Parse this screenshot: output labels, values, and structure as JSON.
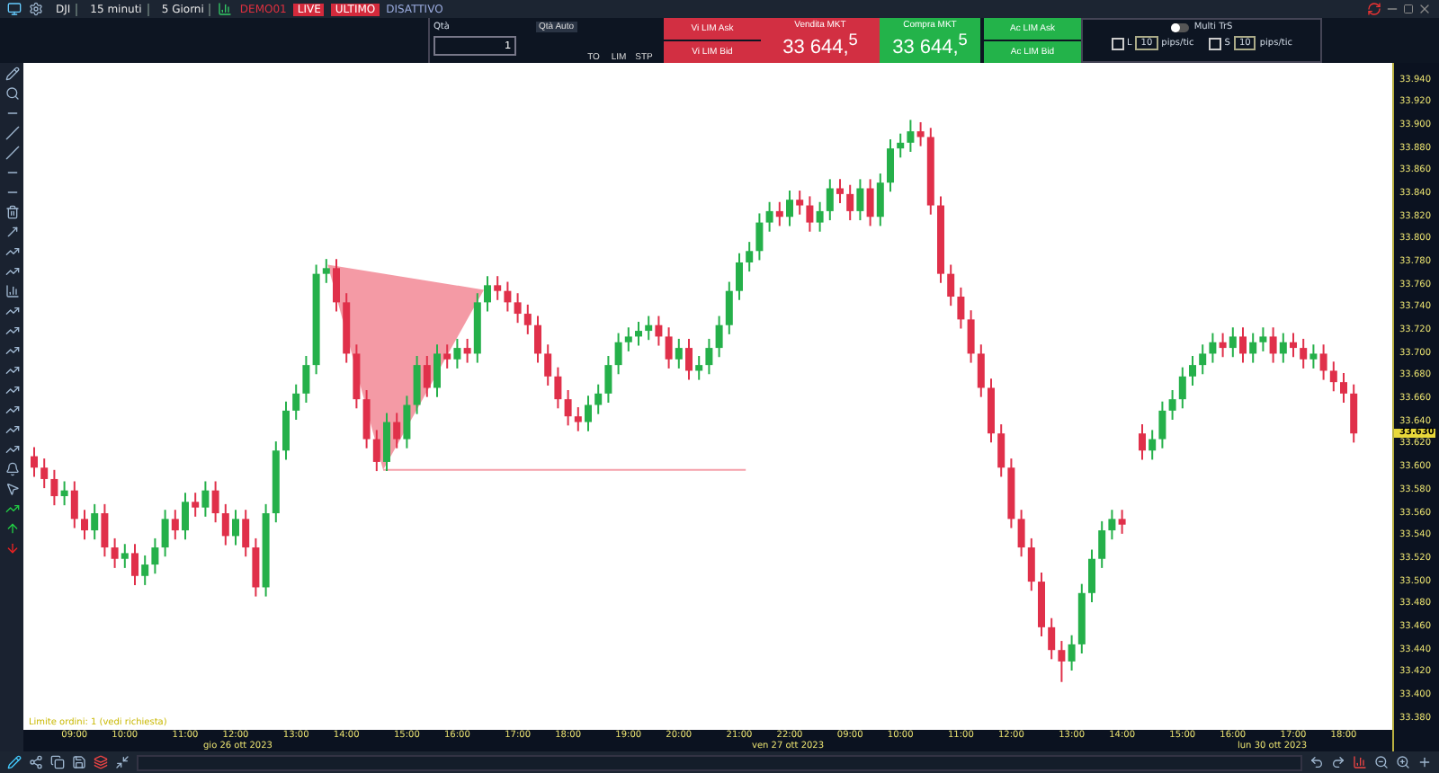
{
  "toolbar": {
    "symbol": "DJI",
    "timeframe": "15 minuti",
    "range": "5 Giorni",
    "account": "DEMO01",
    "badges": [
      "LIVE",
      "ULTIMO"
    ],
    "status": "DISATTIVO"
  },
  "order_panel": {
    "qty_label": "Qtà",
    "qty_auto": "Qtà Auto",
    "qty_value": "1",
    "order_types": [
      {
        "label": "TO"
      },
      {
        "label": "LIM"
      },
      {
        "label": "STP"
      }
    ],
    "sell_limits": [
      "Vi LIM Ask",
      "Vi LIM Bid"
    ],
    "sell": {
      "label": "Vendita MKT",
      "price": "33 644,$^{5}$"
    },
    "buy": {
      "label": "Compra MKT",
      "price": "33 644,$^{5}$"
    },
    "buy_limits": [
      "Ac LIM Ask",
      "Ac LIM Bid"
    ],
    "multi": {
      "label": "Multi TrS",
      "on": false,
      "rows": [
        {
          "side": "L",
          "checked": false,
          "value": "10",
          "unit": "pips/tic"
        },
        {
          "side": "S",
          "checked": false,
          "value": "10",
          "unit": "pips/tic"
        }
      ]
    }
  },
  "chart_data": {
    "type": "candlestick",
    "ylim": [
      33370,
      33955
    ],
    "yticks": [
      {
        "value": 33940,
        "label": "33.940"
      },
      {
        "value": 33920,
        "label": "33.920"
      },
      {
        "value": 33900,
        "label": "33.900"
      },
      {
        "value": 33880,
        "label": "33.880"
      },
      {
        "value": 33860,
        "label": "33.860"
      },
      {
        "value": 33840,
        "label": "33.840"
      },
      {
        "value": 33820,
        "label": "33.820"
      },
      {
        "value": 33800,
        "label": "33.800"
      },
      {
        "value": 33780,
        "label": "33.780"
      },
      {
        "value": 33760,
        "label": "33.760"
      },
      {
        "value": 33740,
        "label": "33.740"
      },
      {
        "value": 33720,
        "label": "33.720"
      },
      {
        "value": 33700,
        "label": "33.700"
      },
      {
        "value": 33680,
        "label": "33.680"
      },
      {
        "value": 33660,
        "label": "33.660"
      },
      {
        "value": 33640,
        "label": "33.640"
      },
      {
        "value": 33620,
        "label": "33.620"
      },
      {
        "value": 33600,
        "label": "33.600"
      },
      {
        "value": 33580,
        "label": "33.580"
      },
      {
        "value": 33560,
        "label": "33.560"
      },
      {
        "value": 33540,
        "label": "33.540"
      },
      {
        "value": 33520,
        "label": "33.520"
      },
      {
        "value": 33500,
        "label": "33.500"
      },
      {
        "value": 33480,
        "label": "33.480"
      },
      {
        "value": 33460,
        "label": "33.460"
      },
      {
        "value": 33440,
        "label": "33.440"
      },
      {
        "value": 33420,
        "label": "33.420"
      },
      {
        "value": 33400,
        "label": "33.400"
      },
      {
        "value": 33380,
        "label": "33.380"
      }
    ],
    "categories": [
      null,
      null,
      null,
      null,
      "09:00",
      null,
      null,
      null,
      null,
      "10:00",
      null,
      null,
      null,
      null,
      null,
      "11:00",
      null,
      null,
      null,
      null,
      "12:00",
      null,
      null,
      null,
      null,
      null,
      "13:00",
      null,
      null,
      null,
      null,
      "14:00",
      null,
      null,
      null,
      null,
      null,
      "15:00",
      null,
      null,
      null,
      null,
      "16:00",
      null,
      null,
      null,
      null,
      null,
      "17:00",
      null,
      null,
      null,
      null,
      "18:00",
      null,
      null,
      null,
      null,
      null,
      "19:00",
      null,
      null,
      null,
      null,
      "20:00",
      null,
      null,
      null,
      null,
      null,
      "21:00",
      null,
      null,
      null,
      null,
      "22:00",
      null,
      null,
      null,
      null,
      null,
      "09:00",
      null,
      null,
      null,
      null,
      "10:00",
      null,
      null,
      null,
      null,
      null,
      "11:00",
      null,
      null,
      null,
      null,
      "12:00",
      null,
      null,
      null,
      null,
      null,
      "13:00",
      null,
      null,
      null,
      null,
      "14:00",
      null,
      null,
      null,
      null,
      null,
      "15:00",
      null,
      null,
      null,
      null,
      "16:00",
      null,
      null,
      null,
      null,
      null,
      "17:00",
      null,
      null,
      null,
      null,
      "18:00",
      null
    ],
    "ohlc": [
      [
        33610,
        33618,
        33592,
        33600
      ],
      [
        33600,
        33608,
        33582,
        33590
      ],
      [
        33590,
        33598,
        33567,
        33575
      ],
      [
        33575,
        33588,
        33567,
        33580
      ],
      [
        33580,
        33588,
        33547,
        33555
      ],
      [
        33555,
        33563,
        33537,
        33545
      ],
      [
        33545,
        33568,
        33537,
        33560
      ],
      [
        33560,
        33568,
        33522,
        33530
      ],
      [
        33530,
        33538,
        33512,
        33520
      ],
      [
        33520,
        33533,
        33512,
        33525
      ],
      [
        33525,
        33533,
        33497,
        33505
      ],
      [
        33505,
        33523,
        33497,
        33515
      ],
      [
        33515,
        33538,
        33507,
        33530
      ],
      [
        33530,
        33563,
        33522,
        33555
      ],
      [
        33555,
        33563,
        33537,
        33545
      ],
      [
        33545,
        33578,
        33537,
        33570
      ],
      [
        33570,
        33578,
        33557,
        33565
      ],
      [
        33565,
        33588,
        33557,
        33580
      ],
      [
        33580,
        33588,
        33552,
        33560
      ],
      [
        33560,
        33568,
        33532,
        33540
      ],
      [
        33540,
        33563,
        33532,
        33555
      ],
      [
        33555,
        33563,
        33522,
        33530
      ],
      [
        33530,
        33538,
        33487,
        33495
      ],
      [
        33495,
        33568,
        33487,
        33560
      ],
      [
        33560,
        33623,
        33552,
        33615
      ],
      [
        33615,
        33658,
        33607,
        33650
      ],
      [
        33650,
        33673,
        33642,
        33665
      ],
      [
        33665,
        33698,
        33657,
        33690
      ],
      [
        33690,
        33778,
        33682,
        33770
      ],
      [
        33770,
        33783,
        33762,
        33775
      ],
      [
        33775,
        33783,
        33737,
        33745
      ],
      [
        33745,
        33753,
        33692,
        33700
      ],
      [
        33700,
        33708,
        33652,
        33660
      ],
      [
        33660,
        33668,
        33617,
        33625
      ],
      [
        33625,
        33633,
        33597,
        33605
      ],
      [
        33605,
        33648,
        33597,
        33640
      ],
      [
        33640,
        33648,
        33617,
        33625
      ],
      [
        33625,
        33663,
        33617,
        33655
      ],
      [
        33655,
        33698,
        33647,
        33690
      ],
      [
        33690,
        33698,
        33662,
        33670
      ],
      [
        33670,
        33708,
        33662,
        33700
      ],
      [
        33700,
        33708,
        33687,
        33695
      ],
      [
        33695,
        33713,
        33687,
        33705
      ],
      [
        33705,
        33713,
        33692,
        33700
      ],
      [
        33700,
        33753,
        33692,
        33745
      ],
      [
        33745,
        33768,
        33737,
        33760
      ],
      [
        33760,
        33768,
        33747,
        33755
      ],
      [
        33755,
        33763,
        33737,
        33745
      ],
      [
        33745,
        33753,
        33727,
        33735
      ],
      [
        33735,
        33743,
        33717,
        33725
      ],
      [
        33725,
        33733,
        33692,
        33700
      ],
      [
        33700,
        33708,
        33672,
        33680
      ],
      [
        33680,
        33688,
        33652,
        33660
      ],
      [
        33660,
        33668,
        33637,
        33645
      ],
      [
        33645,
        33653,
        33632,
        33640
      ],
      [
        33640,
        33663,
        33632,
        33655
      ],
      [
        33655,
        33673,
        33647,
        33665
      ],
      [
        33665,
        33698,
        33657,
        33690
      ],
      [
        33690,
        33718,
        33682,
        33710
      ],
      [
        33710,
        33723,
        33702,
        33715
      ],
      [
        33715,
        33728,
        33707,
        33720
      ],
      [
        33720,
        33733,
        33712,
        33725
      ],
      [
        33725,
        33733,
        33707,
        33715
      ],
      [
        33715,
        33723,
        33687,
        33695
      ],
      [
        33695,
        33713,
        33687,
        33705
      ],
      [
        33705,
        33713,
        33677,
        33685
      ],
      [
        33685,
        33698,
        33677,
        33690
      ],
      [
        33690,
        33713,
        33682,
        33705
      ],
      [
        33705,
        33733,
        33697,
        33725
      ],
      [
        33725,
        33763,
        33717,
        33755
      ],
      [
        33755,
        33788,
        33747,
        33780
      ],
      [
        33780,
        33798,
        33772,
        33790
      ],
      [
        33790,
        33823,
        33782,
        33815
      ],
      [
        33815,
        33833,
        33807,
        33825
      ],
      [
        33825,
        33833,
        33812,
        33820
      ],
      [
        33820,
        33843,
        33812,
        33835
      ],
      [
        33835,
        33843,
        33822,
        33830
      ],
      [
        33830,
        33838,
        33807,
        33815
      ],
      [
        33815,
        33833,
        33807,
        33825
      ],
      [
        33825,
        33853,
        33817,
        33845
      ],
      [
        33845,
        33853,
        33832,
        33840
      ],
      [
        33840,
        33848,
        33817,
        33825
      ],
      [
        33825,
        33853,
        33817,
        33845
      ],
      [
        33845,
        33853,
        33812,
        33820
      ],
      [
        33820,
        33858,
        33812,
        33850
      ],
      [
        33850,
        33888,
        33842,
        33880
      ],
      [
        33880,
        33893,
        33872,
        33885
      ],
      [
        33885,
        33905,
        33877,
        33895
      ],
      [
        33895,
        33903,
        33882,
        33890
      ],
      [
        33890,
        33898,
        33822,
        33830
      ],
      [
        33830,
        33838,
        33762,
        33770
      ],
      [
        33770,
        33778,
        33742,
        33750
      ],
      [
        33750,
        33758,
        33722,
        33730
      ],
      [
        33730,
        33738,
        33692,
        33700
      ],
      [
        33700,
        33708,
        33662,
        33670
      ],
      [
        33670,
        33678,
        33622,
        33630
      ],
      [
        33630,
        33638,
        33592,
        33600
      ],
      [
        33600,
        33608,
        33547,
        33555
      ],
      [
        33555,
        33563,
        33522,
        33530
      ],
      [
        33530,
        33538,
        33492,
        33500
      ],
      [
        33500,
        33508,
        33452,
        33460
      ],
      [
        33460,
        33468,
        33432,
        33440
      ],
      [
        33440,
        33448,
        33412,
        33430
      ],
      [
        33430,
        33453,
        33422,
        33445
      ],
      [
        33445,
        33498,
        33437,
        33490
      ],
      [
        33490,
        33528,
        33482,
        33520
      ],
      [
        33520,
        33553,
        33512,
        33545
      ],
      [
        33545,
        33563,
        33537,
        33555
      ],
      [
        33555,
        33563,
        33542,
        33550
      ],
      null,
      [
        33630,
        33638,
        33607,
        33615
      ],
      [
        33615,
        33633,
        33607,
        33625
      ],
      [
        33625,
        33658,
        33617,
        33650
      ],
      [
        33650,
        33668,
        33642,
        33660
      ],
      [
        33660,
        33688,
        33652,
        33680
      ],
      [
        33680,
        33698,
        33672,
        33690
      ],
      [
        33690,
        33708,
        33682,
        33700
      ],
      [
        33700,
        33718,
        33692,
        33710
      ],
      [
        33710,
        33718,
        33697,
        33705
      ],
      [
        33705,
        33723,
        33697,
        33715
      ],
      [
        33715,
        33723,
        33692,
        33700
      ],
      [
        33700,
        33718,
        33692,
        33710
      ],
      [
        33710,
        33723,
        33702,
        33715
      ],
      [
        33715,
        33723,
        33692,
        33700
      ],
      [
        33700,
        33718,
        33692,
        33710
      ],
      [
        33710,
        33718,
        33697,
        33705
      ],
      [
        33705,
        33713,
        33687,
        33695
      ],
      [
        33695,
        33708,
        33687,
        33700
      ],
      [
        33700,
        33708,
        33677,
        33685
      ],
      [
        33685,
        33693,
        33667,
        33675
      ],
      [
        33675,
        33683,
        33657,
        33665
      ],
      [
        33665,
        33673,
        33622,
        33630
      ]
    ]
  },
  "dates": [
    "gio 26 ott 2023",
    "ven 27 ott 2023",
    "lun 30 ott 2023"
  ],
  "current_price": "33.630",
  "status_text": "Limite ordini: 1 (vedi richiesta)"
}
